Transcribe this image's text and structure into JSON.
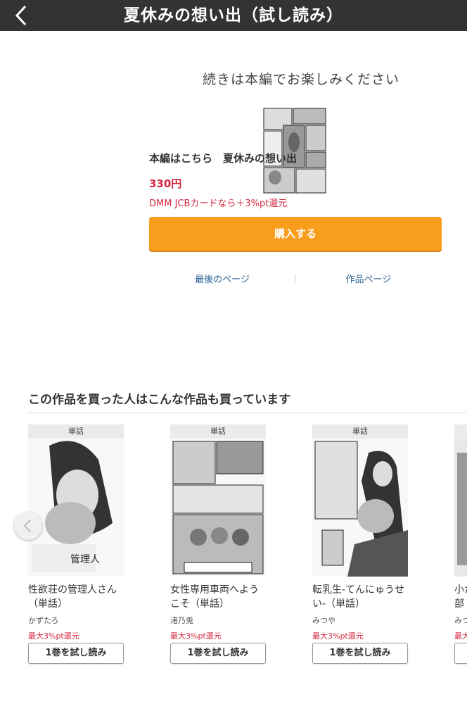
{
  "header": {
    "title": "夏休みの想い出（試し読み）",
    "back_icon": "chevron-left-icon"
  },
  "promo": {
    "message": "続きは本編でお楽しみください",
    "title_line": "本編はこちら　夏休みの想い出",
    "price": "330円",
    "point_note": "DMM JCBカードなら＋3%pt還元",
    "buy_label": "購入する",
    "last_page_link": "最後のページ",
    "work_page_link": "作品ページ"
  },
  "recommend": {
    "heading": "この作品を買った人はこんな作品も買っています",
    "items": [
      {
        "badge": "単話",
        "title": "性欲荘の管理人さん\n（単話）",
        "author": "かずたろ",
        "point": "最大3%pt還元",
        "trial": "1巻を試し読み"
      },
      {
        "badge": "単話",
        "title": "女性専用車両へよう\nこそ（単話）",
        "author": "渚乃兎",
        "point": "最大3%pt還元",
        "trial": "1巻を試し読み"
      },
      {
        "badge": "単話",
        "title": "転乳生-てんにゅうせ\nい-（単話）",
        "author": "みつや",
        "point": "最大3%pt還元",
        "trial": "1巻を試し読み"
      },
      {
        "badge": "単話",
        "title": "小か\n部",
        "author": "みつ",
        "point": "最大",
        "trial": ""
      }
    ]
  },
  "colors": {
    "header_bg": "#333333",
    "buy_button": "#f99d1c",
    "price_red": "#d4283e",
    "link_blue": "#2a6496"
  }
}
